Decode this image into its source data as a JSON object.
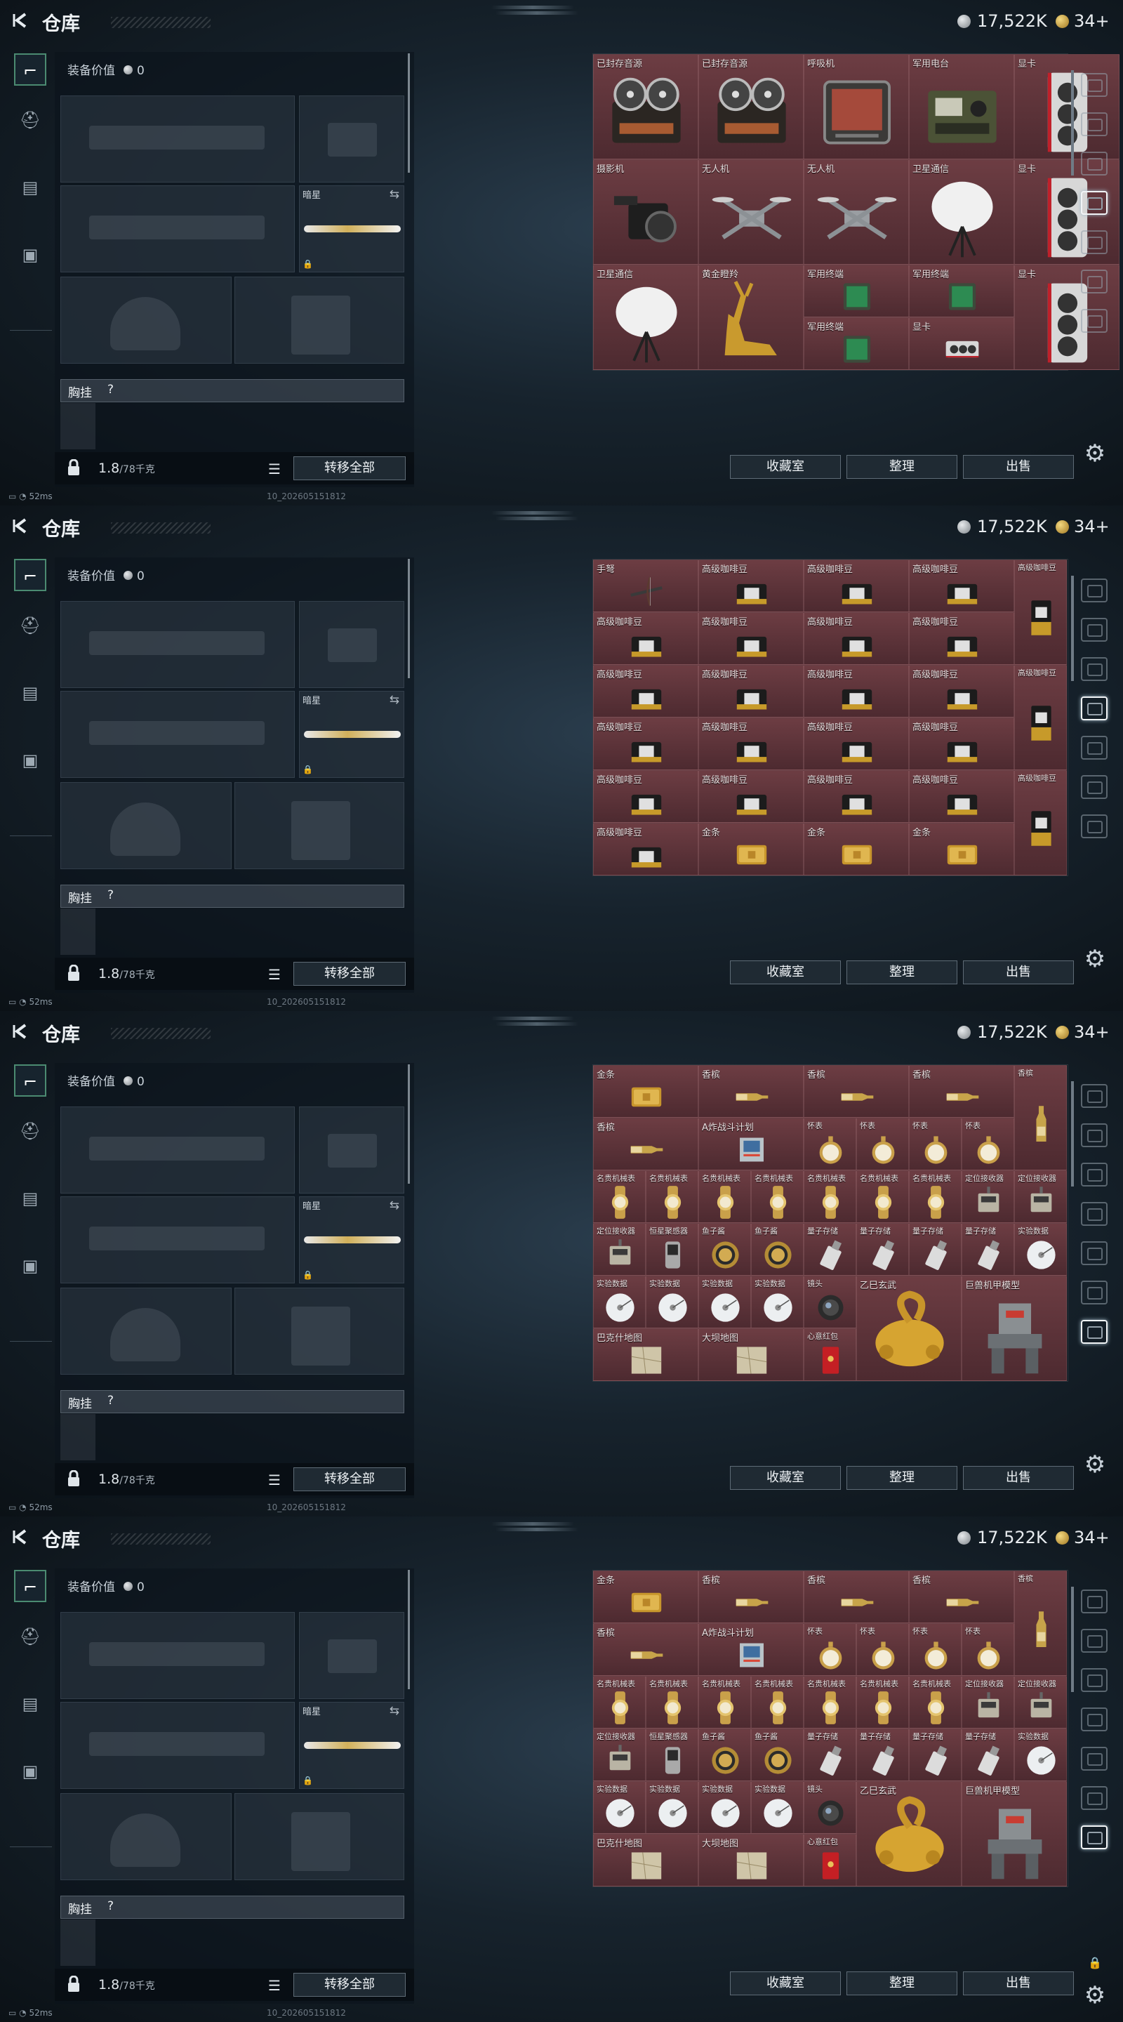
{
  "header": {
    "title": "仓库",
    "silver": "17,522K",
    "gold": "34+"
  },
  "equipment": {
    "value_label": "装备价值",
    "value": "0",
    "slot_dark_star": "暗星",
    "rig_label": "胸挂",
    "rig_q": "?",
    "weight": "1.8",
    "weight_cap": "/78千克",
    "transfer_all": "转移全部"
  },
  "buttons": {
    "collection": "收藏室",
    "sort": "整理",
    "sell": "出售"
  },
  "status": {
    "ping": "52ms",
    "session": "10_2026051518​12"
  },
  "screens": [
    {
      "items": [
        {
          "n": "已封存音源",
          "c": 0,
          "r": 0,
          "w": 1,
          "h": 1,
          "t": "reel"
        },
        {
          "n": "已封存音源",
          "c": 1,
          "r": 0,
          "w": 1,
          "h": 1,
          "t": "reel"
        },
        {
          "n": "呼吸机",
          "c": 2,
          "r": 0,
          "w": 1,
          "h": 1,
          "t": "monitor"
        },
        {
          "n": "军用电台",
          "c": 3,
          "r": 0,
          "w": 1,
          "h": 1,
          "t": "radio"
        },
        {
          "n": "显卡",
          "c": 4,
          "r": 0,
          "w": 1,
          "h": 1,
          "t": "gpuv"
        },
        {
          "n": "摄影机",
          "c": 0,
          "r": 1,
          "w": 1,
          "h": 1,
          "t": "camera"
        },
        {
          "n": "无人机",
          "c": 1,
          "r": 1,
          "w": 1,
          "h": 1,
          "t": "drone"
        },
        {
          "n": "无人机",
          "c": 2,
          "r": 1,
          "w": 1,
          "h": 1,
          "t": "drone"
        },
        {
          "n": "卫星通信",
          "c": 3,
          "r": 1,
          "w": 1,
          "h": 1,
          "t": "dish"
        },
        {
          "n": "显卡",
          "c": 4,
          "r": 1,
          "w": 1,
          "h": 1,
          "t": "gpuv"
        },
        {
          "n": "卫星通信",
          "c": 0,
          "r": 2,
          "w": 1,
          "h": 1,
          "t": "dish"
        },
        {
          "n": "黄金瞪羚",
          "c": 1,
          "r": 2,
          "w": 1,
          "h": 1,
          "t": "gazelle"
        },
        {
          "n": "军用终端",
          "c": 2,
          "r": 2,
          "w": 1,
          "h": 0.5,
          "t": "tablet"
        },
        {
          "n": "军用终端",
          "c": 3,
          "r": 2,
          "w": 1,
          "h": 0.5,
          "t": "tablet"
        },
        {
          "n": "显卡",
          "c": 4,
          "r": 2,
          "w": 1,
          "h": 1,
          "t": "gpuv"
        },
        {
          "n": "军用终端",
          "c": 2,
          "r": 2.5,
          "w": 1,
          "h": 0.5,
          "t": "tablet"
        },
        {
          "n": "显卡",
          "c": 3,
          "r": 2.5,
          "w": 1,
          "h": 0.5,
          "t": "gpuh"
        }
      ]
    },
    {
      "items": [
        {
          "n": "手弩",
          "c": 0,
          "r": 0,
          "w": 1,
          "h": 0.5,
          "t": "xbow"
        },
        {
          "n": "高级咖啡豆",
          "c": 1,
          "r": 0,
          "w": 1,
          "h": 0.5,
          "t": "coffee"
        },
        {
          "n": "高级咖啡豆",
          "c": 2,
          "r": 0,
          "w": 1,
          "h": 0.5,
          "t": "coffee"
        },
        {
          "n": "高级咖啡豆",
          "c": 3,
          "r": 0,
          "w": 1,
          "h": 0.5,
          "t": "coffee"
        },
        {
          "n": "高级咖啡豆",
          "c": 4,
          "r": 0,
          "w": 0.5,
          "h": 1,
          "t": "bag"
        },
        {
          "n": "高级咖啡豆",
          "c": 0,
          "r": 0.5,
          "w": 1,
          "h": 0.5,
          "t": "coffee"
        },
        {
          "n": "高级咖啡豆",
          "c": 1,
          "r": 0.5,
          "w": 1,
          "h": 0.5,
          "t": "coffee"
        },
        {
          "n": "高级咖啡豆",
          "c": 2,
          "r": 0.5,
          "w": 1,
          "h": 0.5,
          "t": "coffee"
        },
        {
          "n": "高级咖啡豆",
          "c": 3,
          "r": 0.5,
          "w": 1,
          "h": 0.5,
          "t": "coffee"
        },
        {
          "n": "高级咖啡豆",
          "c": 0,
          "r": 1,
          "w": 1,
          "h": 0.5,
          "t": "coffee"
        },
        {
          "n": "高级咖啡豆",
          "c": 1,
          "r": 1,
          "w": 1,
          "h": 0.5,
          "t": "coffee"
        },
        {
          "n": "高级咖啡豆",
          "c": 2,
          "r": 1,
          "w": 1,
          "h": 0.5,
          "t": "coffee"
        },
        {
          "n": "高级咖啡豆",
          "c": 3,
          "r": 1,
          "w": 1,
          "h": 0.5,
          "t": "coffee"
        },
        {
          "n": "高级咖啡豆",
          "c": 4,
          "r": 1,
          "w": 0.5,
          "h": 1,
          "t": "bag"
        },
        {
          "n": "高级咖啡豆",
          "c": 0,
          "r": 1.5,
          "w": 1,
          "h": 0.5,
          "t": "coffee"
        },
        {
          "n": "高级咖啡豆",
          "c": 1,
          "r": 1.5,
          "w": 1,
          "h": 0.5,
          "t": "coffee"
        },
        {
          "n": "高级咖啡豆",
          "c": 2,
          "r": 1.5,
          "w": 1,
          "h": 0.5,
          "t": "coffee"
        },
        {
          "n": "高级咖啡豆",
          "c": 3,
          "r": 1.5,
          "w": 1,
          "h": 0.5,
          "t": "coffee"
        },
        {
          "n": "高级咖啡豆",
          "c": 0,
          "r": 2,
          "w": 1,
          "h": 0.5,
          "t": "coffee"
        },
        {
          "n": "高级咖啡豆",
          "c": 1,
          "r": 2,
          "w": 1,
          "h": 0.5,
          "t": "coffee"
        },
        {
          "n": "高级咖啡豆",
          "c": 2,
          "r": 2,
          "w": 1,
          "h": 0.5,
          "t": "coffee"
        },
        {
          "n": "高级咖啡豆",
          "c": 3,
          "r": 2,
          "w": 1,
          "h": 0.5,
          "t": "coffee"
        },
        {
          "n": "高级咖啡豆",
          "c": 4,
          "r": 2,
          "w": 0.5,
          "h": 1,
          "t": "bag"
        },
        {
          "n": "高级咖啡豆",
          "c": 0,
          "r": 2.5,
          "w": 1,
          "h": 0.5,
          "t": "coffee"
        },
        {
          "n": "金条",
          "c": 1,
          "r": 2.5,
          "w": 1,
          "h": 0.5,
          "t": "gold"
        },
        {
          "n": "金条",
          "c": 2,
          "r": 2.5,
          "w": 1,
          "h": 0.5,
          "t": "gold"
        },
        {
          "n": "金条",
          "c": 3,
          "r": 2.5,
          "w": 1,
          "h": 0.5,
          "t": "gold"
        }
      ]
    },
    {
      "items": [
        {
          "n": "金条",
          "c": 0,
          "r": 0,
          "w": 1,
          "h": 0.5,
          "t": "gold"
        },
        {
          "n": "香槟",
          "c": 1,
          "r": 0,
          "w": 1,
          "h": 0.5,
          "t": "bottle"
        },
        {
          "n": "香槟",
          "c": 2,
          "r": 0,
          "w": 1,
          "h": 0.5,
          "t": "bottle"
        },
        {
          "n": "香槟",
          "c": 3,
          "r": 0,
          "w": 1,
          "h": 0.5,
          "t": "bottle"
        },
        {
          "n": "香槟",
          "c": 4,
          "r": 0,
          "w": 0.5,
          "h": 1,
          "t": "vbottle"
        },
        {
          "n": "香槟",
          "c": 0,
          "r": 0.5,
          "w": 1,
          "h": 0.5,
          "t": "bottle"
        },
        {
          "n": "A炸战斗计划",
          "c": 1,
          "r": 0.5,
          "w": 1,
          "h": 0.5,
          "t": "plan"
        },
        {
          "n": "怀表",
          "c": 2,
          "r": 0.5,
          "w": 0.5,
          "h": 0.5,
          "t": "watch"
        },
        {
          "n": "怀表",
          "c": 2.5,
          "r": 0.5,
          "w": 0.5,
          "h": 0.5,
          "t": "watch"
        },
        {
          "n": "怀表",
          "c": 3,
          "r": 0.5,
          "w": 0.5,
          "h": 0.5,
          "t": "watch"
        },
        {
          "n": "怀表",
          "c": 3.5,
          "r": 0.5,
          "w": 0.5,
          "h": 0.5,
          "t": "watch"
        },
        {
          "n": "名贵机械表",
          "c": 0,
          "r": 1,
          "w": 0.5,
          "h": 0.5,
          "t": "rolex"
        },
        {
          "n": "名贵机械表",
          "c": 0.5,
          "r": 1,
          "w": 0.5,
          "h": 0.5,
          "t": "rolex"
        },
        {
          "n": "名贵机械表",
          "c": 1,
          "r": 1,
          "w": 0.5,
          "h": 0.5,
          "t": "rolex"
        },
        {
          "n": "名贵机械表",
          "c": 1.5,
          "r": 1,
          "w": 0.5,
          "h": 0.5,
          "t": "rolex"
        },
        {
          "n": "名贵机械表",
          "c": 2,
          "r": 1,
          "w": 0.5,
          "h": 0.5,
          "t": "rolex"
        },
        {
          "n": "名贵机械表",
          "c": 2.5,
          "r": 1,
          "w": 0.5,
          "h": 0.5,
          "t": "rolex"
        },
        {
          "n": "名贵机械表",
          "c": 3,
          "r": 1,
          "w": 0.5,
          "h": 0.5,
          "t": "rolex"
        },
        {
          "n": "定位接收器",
          "c": 3.5,
          "r": 1,
          "w": 0.5,
          "h": 0.5,
          "t": "device"
        },
        {
          "n": "定位接收器",
          "c": 4,
          "r": 1,
          "w": 0.5,
          "h": 0.5,
          "t": "device"
        },
        {
          "n": "定位接收器",
          "c": 0,
          "r": 1.5,
          "w": 0.5,
          "h": 0.5,
          "t": "device"
        },
        {
          "n": "恒星聚感器",
          "c": 0.5,
          "r": 1.5,
          "w": 0.5,
          "h": 0.5,
          "t": "sensor"
        },
        {
          "n": "鱼子酱",
          "c": 1,
          "r": 1.5,
          "w": 0.5,
          "h": 0.5,
          "t": "tin"
        },
        {
          "n": "鱼子酱",
          "c": 1.5,
          "r": 1.5,
          "w": 0.5,
          "h": 0.5,
          "t": "tin"
        },
        {
          "n": "量子存储",
          "c": 2,
          "r": 1.5,
          "w": 0.5,
          "h": 0.5,
          "t": "usb"
        },
        {
          "n": "量子存储",
          "c": 2.5,
          "r": 1.5,
          "w": 0.5,
          "h": 0.5,
          "t": "usb"
        },
        {
          "n": "量子存储",
          "c": 3,
          "r": 1.5,
          "w": 0.5,
          "h": 0.5,
          "t": "usb"
        },
        {
          "n": "量子存储",
          "c": 3.5,
          "r": 1.5,
          "w": 0.5,
          "h": 0.5,
          "t": "usb"
        },
        {
          "n": "实验数据",
          "c": 4,
          "r": 1.5,
          "w": 0.5,
          "h": 0.5,
          "t": "disc"
        },
        {
          "n": "实验数据",
          "c": 0,
          "r": 2,
          "w": 0.5,
          "h": 0.5,
          "t": "disc"
        },
        {
          "n": "实验数据",
          "c": 0.5,
          "r": 2,
          "w": 0.5,
          "h": 0.5,
          "t": "disc"
        },
        {
          "n": "实验数据",
          "c": 1,
          "r": 2,
          "w": 0.5,
          "h": 0.5,
          "t": "disc"
        },
        {
          "n": "实验数据",
          "c": 1.5,
          "r": 2,
          "w": 0.5,
          "h": 0.5,
          "t": "disc"
        },
        {
          "n": "镜头",
          "c": 2,
          "r": 2,
          "w": 0.5,
          "h": 0.5,
          "t": "lens"
        },
        {
          "n": "乙巳玄武",
          "c": 2.5,
          "r": 2,
          "w": 1,
          "h": 1,
          "t": "turtle"
        },
        {
          "n": "巨兽机甲模型",
          "c": 3.5,
          "r": 2,
          "w": 1,
          "h": 1,
          "t": "mech"
        },
        {
          "n": "巴克什地图",
          "c": 0,
          "r": 2.5,
          "w": 1,
          "h": 0.5,
          "t": "map"
        },
        {
          "n": "大坝地图",
          "c": 1,
          "r": 2.5,
          "w": 1,
          "h": 0.5,
          "t": "map"
        },
        {
          "n": "心意红包",
          "c": 2,
          "r": 2.5,
          "w": 0.5,
          "h": 0.5,
          "t": "envelope"
        }
      ]
    }
  ],
  "screen_variant": [
    0,
    1,
    2,
    2
  ],
  "icons": [
    "back-arrow-icon",
    "silver-coin-icon",
    "gold-coin-icon",
    "gun-icon",
    "helmet-icon",
    "vest-icon",
    "case-icon",
    "lock-icon",
    "swap-icon",
    "list-icon",
    "gear-icon"
  ]
}
